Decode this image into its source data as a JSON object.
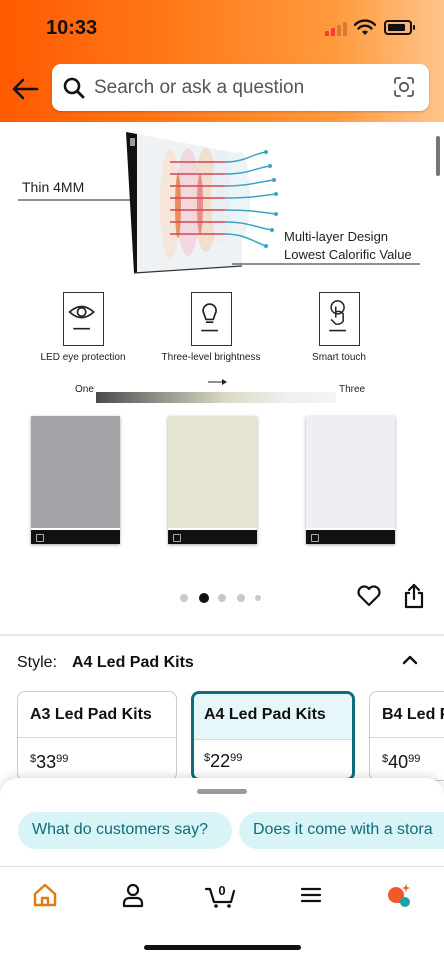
{
  "status_bar": {
    "time": "10:33"
  },
  "header": {
    "back_icon": "arrow-left-icon",
    "search_placeholder": "Search or ask a question",
    "lens_icon": "camera-lens-icon",
    "colors": {
      "gradient_start": "#ff5a00",
      "gradient_end": "#ffc48a"
    }
  },
  "product_image": {
    "thin_label": "Thin 4MM",
    "multi_layer_line1": "Multi-layer Design",
    "multi_layer_line2": "Lowest Calorific Value",
    "features": [
      {
        "icon": "eye-icon",
        "label": "LED eye protection"
      },
      {
        "icon": "bulb-icon",
        "label": "Three-level brightness"
      },
      {
        "icon": "touch-icon",
        "label": "Smart touch"
      }
    ],
    "brightness_start": "One",
    "brightness_end": "Three",
    "carousel": {
      "total": 5,
      "active_index": 1
    }
  },
  "actions": {
    "wishlist_icon": "heart-icon",
    "share_icon": "share-icon"
  },
  "style_selector": {
    "key": "Style:",
    "value": "A4 Led Pad Kits",
    "options": [
      {
        "title": "A3 Led Pad Kits",
        "price_currency": "$",
        "price_whole": "33",
        "price_fraction": "99",
        "selected": false
      },
      {
        "title": "A4 Led Pad Kits",
        "price_currency": "$",
        "price_whole": "22",
        "price_fraction": "99",
        "selected": true
      },
      {
        "title": "B4 Led P",
        "price_currency": "$",
        "price_whole": "40",
        "price_fraction": "99",
        "selected": false
      }
    ],
    "accent_color": "#0d6e7a"
  },
  "suggestions": [
    "What do customers say?",
    "Does it come with a stora"
  ],
  "tabbar": {
    "tabs": [
      "home-icon",
      "account-icon",
      "cart-icon",
      "menu-icon",
      "rufus-assistant-icon"
    ],
    "cart_count": "0",
    "active_color": "#e47911"
  }
}
